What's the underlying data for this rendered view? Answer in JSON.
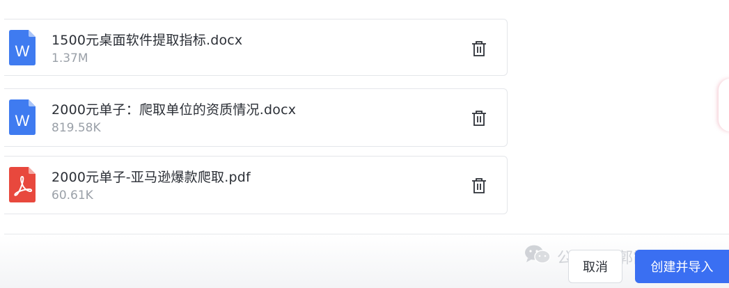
{
  "files": [
    {
      "type": "docx",
      "icon": "word-file-icon",
      "icon_letter": "W",
      "name": "1500元桌面软件提取指标.docx",
      "size": "1.37M"
    },
    {
      "type": "docx",
      "icon": "word-file-icon",
      "icon_letter": "W",
      "name": "2000元单子：爬取单位的资质情况.docx",
      "size": "819.58K"
    },
    {
      "type": "pdf",
      "icon": "pdf-file-icon",
      "name": "2000元单子-亚马逊爆款爬取.pdf",
      "size": "60.61K"
    }
  ],
  "footer": {
    "watermark": "公众号 · 郭霞AI",
    "cancel_label": "取消",
    "primary_label": "创建并导入"
  },
  "colors": {
    "word_blue": "#3f7bf0",
    "pdf_red": "#e8483d",
    "primary_blue": "#3a6ff2",
    "text_main": "#2b2f36",
    "text_secondary": "#9aa0a8"
  }
}
